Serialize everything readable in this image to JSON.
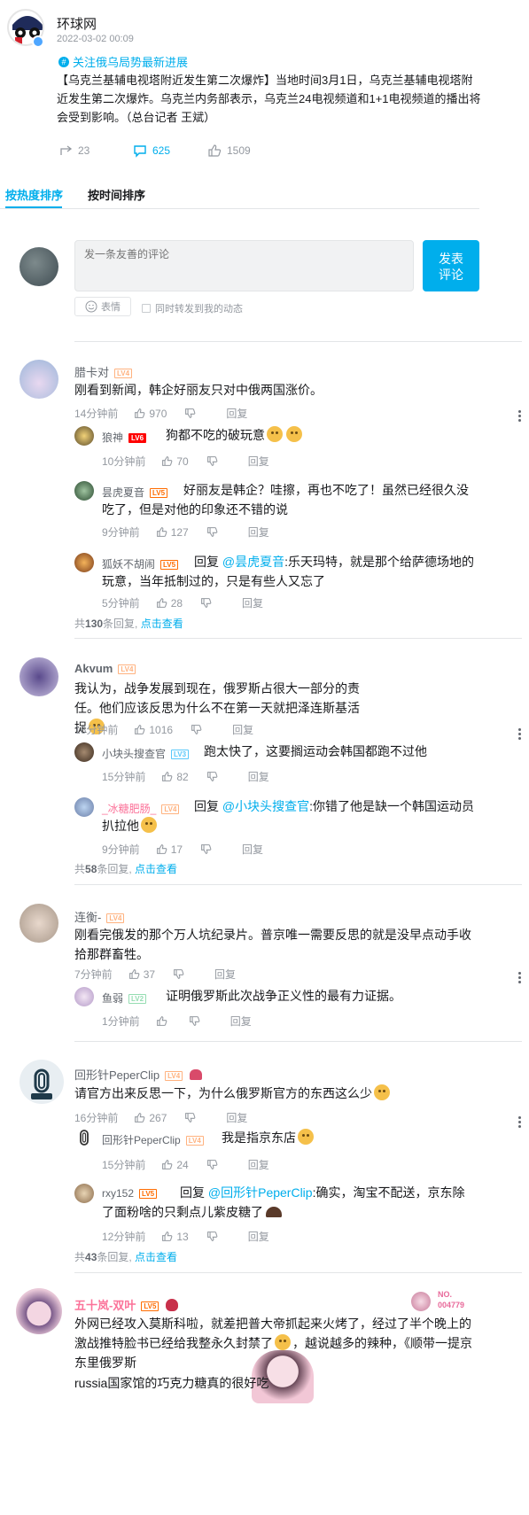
{
  "post": {
    "author": "环球网",
    "date": "2022-03-02 00:09",
    "topic": "关注俄乌局势最新进展",
    "content": "【乌克兰基辅电视塔附近发生第二次爆炸】当地时间3月1日，乌克兰基辅电视塔附近发生第二次爆炸。乌克兰内务部表示，乌克兰24电视频道和1+1电视频道的播出将会受到影响。（总台记者 王斌）",
    "shares": "23",
    "comments": "625",
    "likes": "1509"
  },
  "sort": {
    "hot": "按热度排序",
    "time": "按时间排序"
  },
  "composer": {
    "placeholder": "发一条友善的评论",
    "submit_line1": "发表",
    "submit_line2": "评论",
    "emoji": "表情",
    "repost": "同时转发到我的动态"
  },
  "labels": {
    "reply": "回复",
    "total_prefix": "共",
    "total_suffix": "条回复, ",
    "view": "点击查看"
  },
  "comments": [
    {
      "user": "腊卡对",
      "level": "LV4",
      "text": "刚看到新闻，韩企好丽友只对中俄两国涨价。",
      "time": "14分钟前",
      "likes": "970",
      "replies": [
        {
          "user": "狼神",
          "level": "LV6",
          "text": "狗都不吃的破玩意",
          "time": "10分钟前",
          "likes": "70"
        },
        {
          "user": "昙虎夏音",
          "level": "LV5",
          "text": "好丽友是韩企？哇擦，再也不吃了！虽然已经很久没吃了，但是对他的印象还不错的说",
          "time": "9分钟前",
          "likes": "127"
        },
        {
          "user": "狐妖不胡闹",
          "level": "LV5",
          "to": "@昙虎夏音",
          "text": ":乐天玛特，就是那个给萨德场地的玩意，当年抵制过的，只是有些人又忘了",
          "time": "5分钟前",
          "likes": "28"
        }
      ],
      "total": "130"
    },
    {
      "user": "Akvum",
      "level": "LV4",
      "text": "我认为，战争发展到现在，俄罗斯占很大一部分的责任。他们应该反思为什么不在第一天就把泽连斯基活捉",
      "time": "16分钟前",
      "likes": "1016",
      "replies": [
        {
          "user": "小块头搜查官",
          "level": "LV3",
          "text": "跑太快了，这要搁运动会韩国都跑不过他",
          "time": "15分钟前",
          "likes": "82"
        },
        {
          "user": "_冰糖肥肠_",
          "level": "LV4",
          "to": "@小块头搜查官",
          "text": ":你错了他是缺一个韩国运动员扒拉他",
          "time": "9分钟前",
          "likes": "17"
        }
      ],
      "total": "58"
    },
    {
      "user": "连衡-",
      "level": "LV4",
      "text": "刚看完俄发的那个万人坑纪录片。普京唯一需要反思的就是没早点动手收拾那群畜牲。",
      "time": "7分钟前",
      "likes": "37",
      "replies": [
        {
          "user": "鱼弱",
          "level": "LV2",
          "text": "证明俄罗斯此次战争正义性的最有力证据。",
          "time": "1分钟前",
          "likes": ""
        }
      ]
    },
    {
      "user": "回形针PeperClip",
      "level": "LV4",
      "text": "请官方出来反思一下，为什么俄罗斯官方的东西这么少",
      "time": "16分钟前",
      "likes": "267",
      "replies": [
        {
          "user": "回形针PeperClip",
          "level": "LV4",
          "text": "我是指京东店",
          "time": "15分钟前",
          "likes": "24"
        },
        {
          "user": "rxy152",
          "level": "LV5",
          "to": "@回形针PeperClip",
          "text": ":确实，淘宝不配送，京东除了面粉啥的只剩点儿紫皮糖了",
          "time": "12分钟前",
          "likes": "13"
        }
      ],
      "total": "43"
    },
    {
      "user": "五十岚-双叶",
      "level": "LV5",
      "text": "外网已经攻入莫斯科啦，就差把普大帝抓起来火烤了，经过了半个晚上的激战推特脸书已经给我整永久封禁了",
      "text2": "，越说越多的辣种，《顺带一提京东里俄罗斯",
      "text3": "russia国家馆的巧克力糖真的很好吃",
      "badge1": "NO.",
      "badge2": "004779"
    }
  ],
  "colors": {
    "accent": "#00aeec",
    "name": "#61666d",
    "vip": "#fb7299",
    "lv4": "#ffb27f",
    "lv5": "#ff6c00",
    "lv6": "#f00",
    "lv3": "#5ac8fa",
    "lv2": "#95ddb2"
  }
}
